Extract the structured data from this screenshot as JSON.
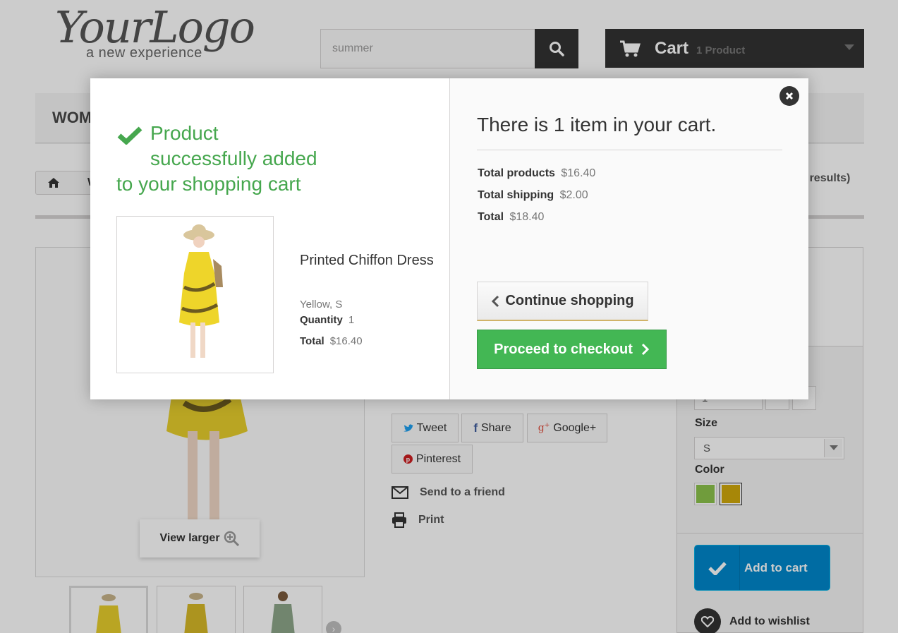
{
  "header": {
    "logo_main": "YourLogo",
    "logo_sub": "a new experience",
    "search_value": "summer",
    "cart_label": "Cart",
    "cart_count": "1 Product"
  },
  "menu": {
    "first_item": "WOM"
  },
  "breadcrumb": {
    "current_partial": "W",
    "results_partial": "er results)"
  },
  "product_page": {
    "view_larger": "View larger",
    "social": {
      "tweet": "Tweet",
      "share": "Share",
      "google": "Google+",
      "pinterest": "Pinterest"
    },
    "send_to_friend": "Send to a friend",
    "print": "Print",
    "size_label": "Size",
    "size_value": "S",
    "color_label": "Color",
    "colors": [
      "#8cc34b",
      "#d1a90b"
    ],
    "add_to_cart": "Add to cart",
    "add_to_wishlist": "Add to wishlist",
    "qty_partial": "1"
  },
  "modal": {
    "success_line1": "Product",
    "success_line2": "successfully added",
    "success_line3": "to your shopping cart",
    "product_name": "Printed Chiffon Dress",
    "attributes": "Yellow, S",
    "quantity_label": "Quantity",
    "quantity_value": "1",
    "total_label": "Total",
    "total_value": "$16.40",
    "cart_title": "There is 1 item in your cart.",
    "total_products_label": "Total products",
    "total_products_value": "$16.40",
    "total_shipping_label": "Total shipping",
    "total_shipping_value": "$2.00",
    "grand_total_label": "Total",
    "grand_total_value": "$18.40",
    "continue_shopping": "Continue shopping",
    "proceed_checkout": "Proceed to checkout"
  },
  "colors": {
    "success_green": "#46a74e",
    "checkout_green": "#43b754",
    "cart_dark": "#333333",
    "add_to_cart_blue": "#0088cc"
  }
}
